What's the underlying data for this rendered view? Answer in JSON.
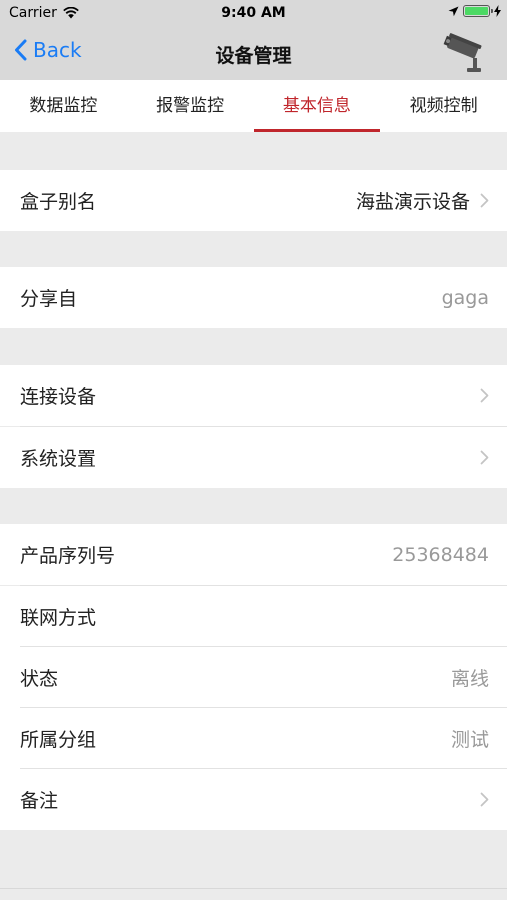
{
  "status_bar": {
    "carrier": "Carrier",
    "time": "9:40 AM"
  },
  "nav": {
    "back_label": "Back",
    "title": "设备管理"
  },
  "tabs": [
    {
      "label": "数据监控",
      "active": false
    },
    {
      "label": "报警监控",
      "active": false
    },
    {
      "label": "基本信息",
      "active": true
    },
    {
      "label": "视频控制",
      "active": false
    }
  ],
  "info": {
    "alias": {
      "label": "盒子别名",
      "value": "海盐演示设备"
    },
    "shared_from": {
      "label": "分享自",
      "value": "gaga"
    },
    "connect_device": {
      "label": "连接设备"
    },
    "system_settings": {
      "label": "系统设置"
    },
    "serial": {
      "label": "产品序列号",
      "value": "25368484"
    },
    "network": {
      "label": "联网方式",
      "value": ""
    },
    "state": {
      "label": "状态",
      "value": "离线"
    },
    "group": {
      "label": "所属分组",
      "value": "测试"
    },
    "remark": {
      "label": "备注"
    }
  },
  "colors": {
    "accent": "#c0262c",
    "link": "#1a7cf5",
    "background": "#ebebeb"
  }
}
